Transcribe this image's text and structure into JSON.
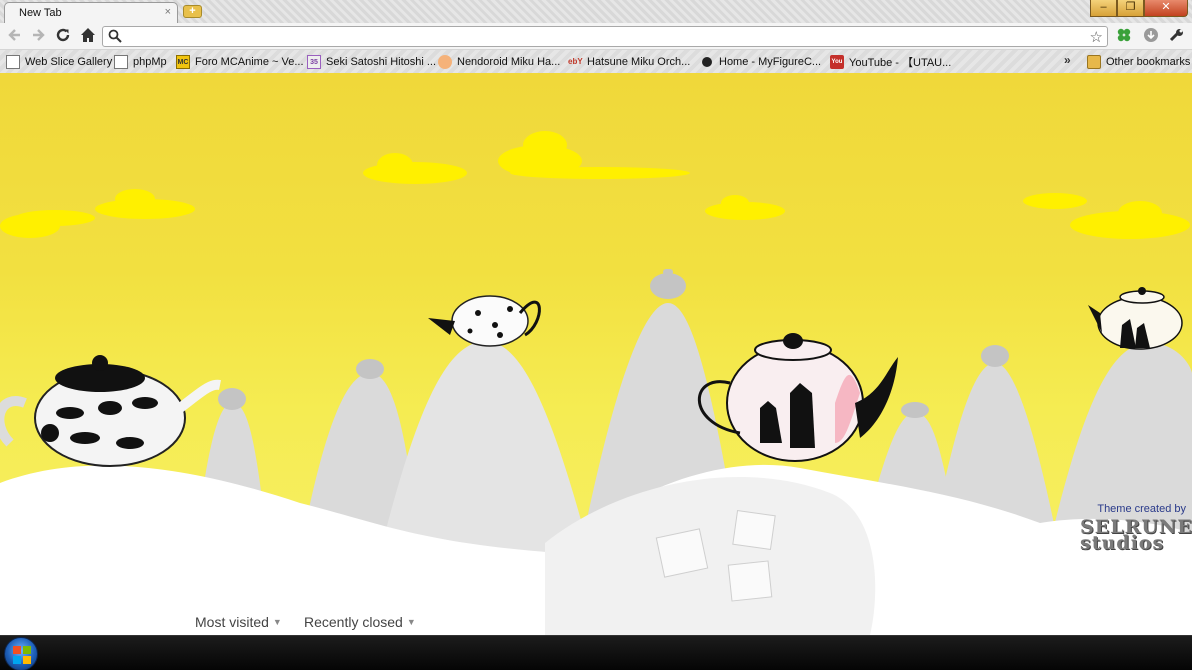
{
  "window": {
    "tab_title": "New Tab",
    "tab_close": "×",
    "newtab_label": "+",
    "minimize": "‒",
    "restore": "❐",
    "close": "✕"
  },
  "toolbar": {
    "back_icon": "arrow-left-icon",
    "forward_icon": "arrow-right-icon",
    "reload_icon": "reload-icon",
    "home_icon": "home-icon",
    "omnibox_value": "",
    "omnibox_placeholder": "",
    "star_icon": "star-icon",
    "extensions": [
      "clover-icon",
      "download-icon"
    ],
    "wrench_icon": "wrench-icon"
  },
  "bookmarks": {
    "items": [
      {
        "label": "Web Slice Gallery",
        "icon": "page-icon"
      },
      {
        "label": "phpMp",
        "icon": "page-icon"
      },
      {
        "label": "Foro MCAnime ~ Ve...",
        "icon": "mcanime-icon"
      },
      {
        "label": "Seki Satoshi Hitoshi ...",
        "icon": "site-35-icon"
      },
      {
        "label": "Nendoroid Miku Ha...",
        "icon": "nendoroid-icon"
      },
      {
        "label": "Hatsune Miku Orch...",
        "icon": "ebay-icon"
      },
      {
        "label": "Home - MyFigureC...",
        "icon": "mfc-icon"
      },
      {
        "label": "YouTube - 【UTAU...",
        "icon": "youtube-icon"
      }
    ],
    "overflow": "»",
    "other": "Other bookmarks"
  },
  "ntp": {
    "theme_credit": "Theme created by",
    "studio_line1": "SELRUNE",
    "studio_line2": "studios",
    "most_visited": "Most visited",
    "recently_closed": "Recently closed"
  },
  "colors": {
    "sky_top": "#f0d83a",
    "sky_bottom": "#f7f06a",
    "sugar": "#ffffff",
    "mountains": "#dcdcdc",
    "clouds": "#ffee00"
  }
}
